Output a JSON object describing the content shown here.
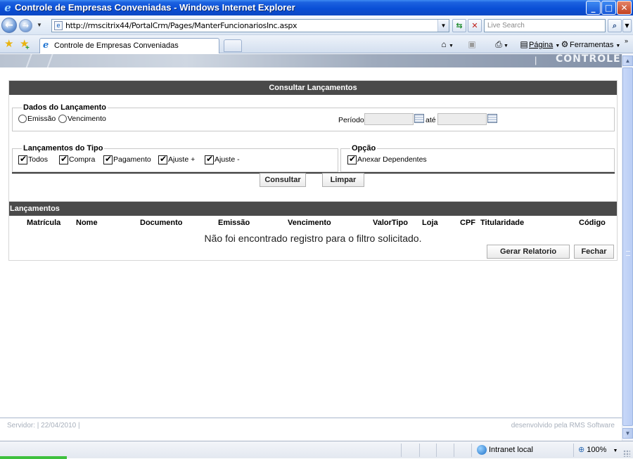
{
  "window": {
    "title": "Controle de Empresas Conveniadas - Windows Internet Explorer",
    "controls": {
      "minimize": "_",
      "maximize": "□",
      "close": "✕"
    }
  },
  "browser": {
    "url": "http://rmscitrix44/PortalCrm/Pages/ManterFuncionariosInc.aspx",
    "search_placeholder": "Live Search",
    "tab_title": "Controle de Empresas Conveniadas",
    "commands": {
      "pagina": "Página",
      "ferramentas": "Ferramentas"
    },
    "icons": [
      "back-arrow",
      "forward-arrow",
      "refresh-icon",
      "stop-icon",
      "search-icon",
      "favorites-star",
      "add-favorites-star",
      "home-icon",
      "feeds-icon",
      "print-icon",
      "page-icon",
      "tools-gear-icon"
    ]
  },
  "page_header": {
    "brand": "CONTROLE",
    "separator": "|"
  },
  "consultar": {
    "title": "Consultar Lançamentos",
    "dados": {
      "legend": "Dados do Lançamento",
      "emissao": "Emissão",
      "vencimento": "Vencimento",
      "periodo_label": "Período:",
      "ate_label": "até",
      "periodo_inicio": "",
      "periodo_fim": ""
    },
    "tipo": {
      "legend": "Lançamentos do Tipo",
      "todos": "Todos",
      "compra": "Compra",
      "pagamento": "Pagamento",
      "ajuste_mais": "Ajuste +",
      "ajuste_menos": "Ajuste -"
    },
    "opcao": {
      "legend": "Opção",
      "anexar": "Anexar Dependentes"
    },
    "buttons": {
      "consultar": "Consultar",
      "limpar": "Limpar"
    }
  },
  "lancamentos": {
    "title": "Lançamentos",
    "columns": [
      "Matrícula",
      "Nome",
      "Documento",
      "Emissão",
      "Vencimento",
      "ValorTipo",
      "Loja",
      "CPF",
      "Titularidade",
      "Código"
    ],
    "empty_message": "Não foi encontrado registro para o filtro solicitado.",
    "buttons": {
      "gerar": "Gerar Relatorio",
      "fechar": "Fechar"
    }
  },
  "footer": {
    "left": "Servidor:   |   22/04/2010   |",
    "right": "desenvolvido pela RMS Software"
  },
  "statusbar": {
    "zone": "Intranet local",
    "zoom": "100%"
  },
  "colors": {
    "title_bar": "#0a4ed6",
    "panel_header": "#4a4a4a",
    "progress": "#3ec03e"
  }
}
